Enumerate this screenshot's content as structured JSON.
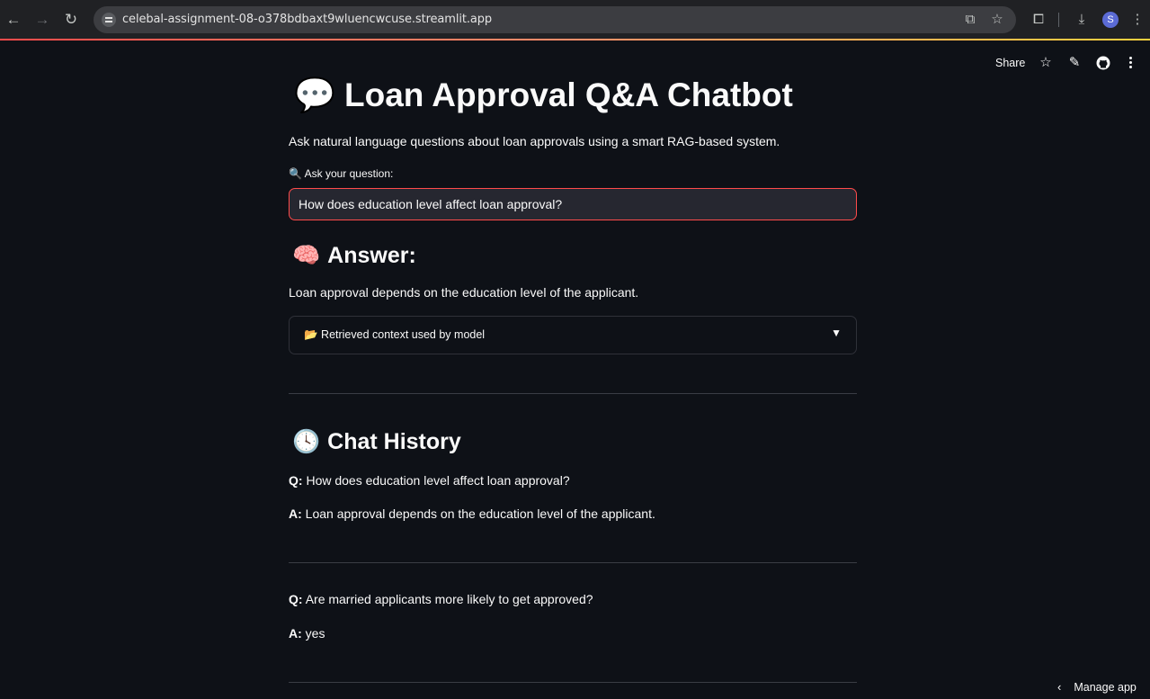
{
  "browser": {
    "url": "celebal-assignment-08-o378bdbaxt9wluencwcuse.streamlit.app",
    "back_icon": "arrow-left-icon",
    "forward_icon": "arrow-right-icon",
    "reload_icon": "reload-icon",
    "profile_initial": "S"
  },
  "header": {
    "share_label": "Share"
  },
  "page": {
    "title_emoji": "💬",
    "title": "Loan Approval Q&A Chatbot",
    "subtitle": "Ask natural language questions about loan approvals using a smart RAG-based system.",
    "question_label": "🔍 Ask your question:",
    "question_value": "How does education level affect loan approval?",
    "answer_emoji": "🧠",
    "answer_heading": "Answer:",
    "answer_text": "Loan approval depends on the education level of the applicant.",
    "expander_label": "📂 Retrieved context used by model",
    "history_emoji": "🕓",
    "history_heading": "Chat History",
    "history": [
      {
        "q_prefix": "Q:",
        "q": "How does education level affect loan approval?",
        "a_prefix": "A:",
        "a": "Loan approval depends on the education level of the applicant."
      },
      {
        "q_prefix": "Q:",
        "q": "Are married applicants more likely to get approved?",
        "a_prefix": "A:",
        "a": "yes"
      }
    ]
  },
  "footer": {
    "manage_label": "Manage app"
  },
  "colors": {
    "background": "#0e1117",
    "accent": "#ff4b4b",
    "input_bg": "#262730"
  }
}
